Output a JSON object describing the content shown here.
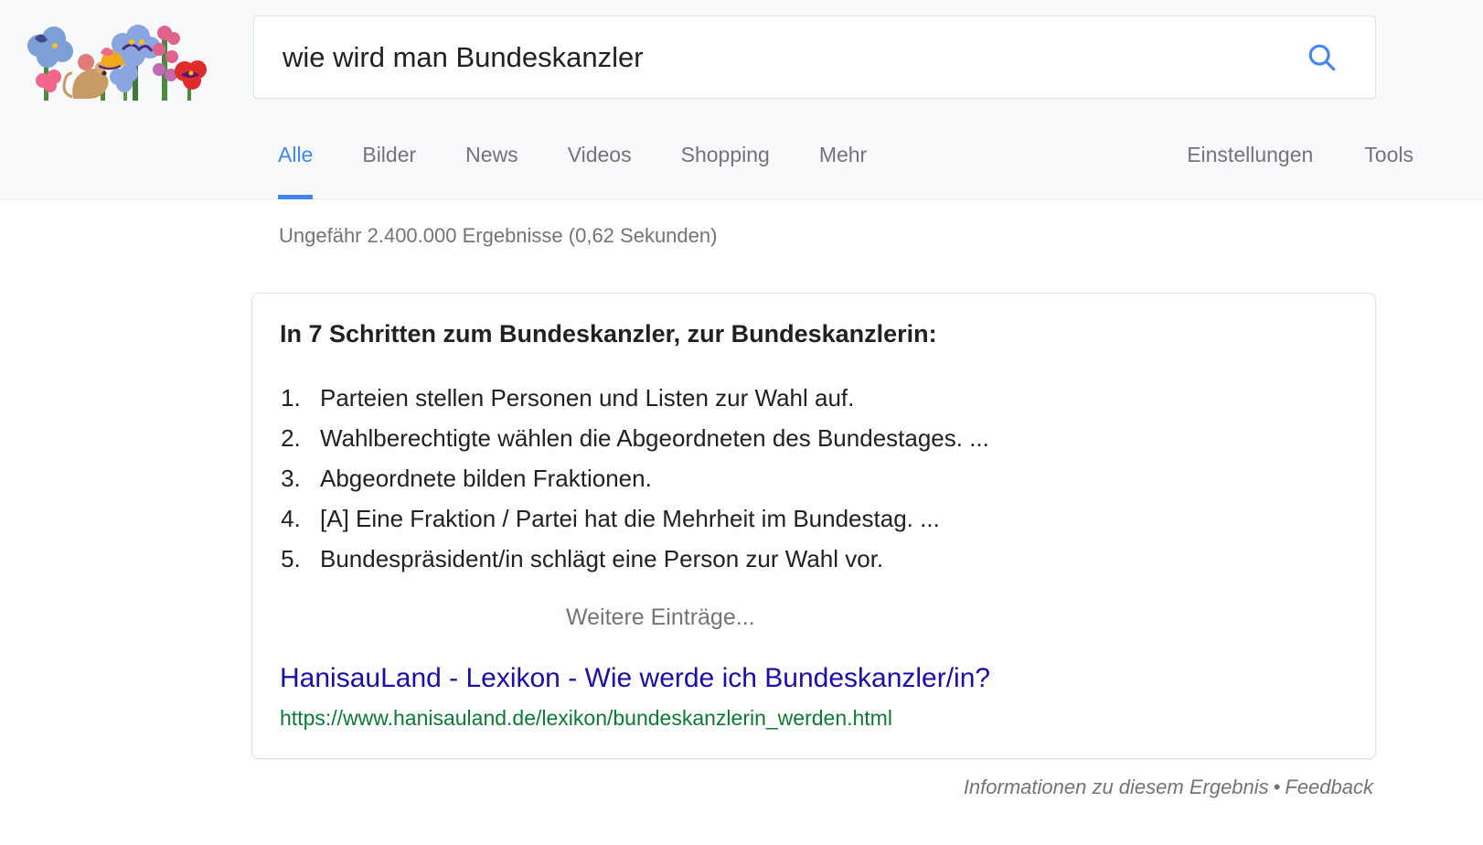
{
  "doodle": {
    "name": "google-doodle-flowers-mouse",
    "description": "Illustrated flowers with a mouse"
  },
  "search": {
    "value": "wie wird man Bundeskanzler",
    "placeholder": "",
    "search_icon": "search-icon"
  },
  "tabs": [
    {
      "label": "Alle",
      "active": true
    },
    {
      "label": "Bilder",
      "active": false
    },
    {
      "label": "News",
      "active": false
    },
    {
      "label": "Videos",
      "active": false
    },
    {
      "label": "Shopping",
      "active": false
    },
    {
      "label": "Mehr",
      "active": false
    }
  ],
  "tools": [
    {
      "label": "Einstellungen"
    },
    {
      "label": "Tools"
    }
  ],
  "result_stats": "Ungefähr 2.400.000 Ergebnisse (0,62 Sekunden)",
  "snippet": {
    "heading": "In 7 Schritten zum Bundeskanzler, zur Bundeskanzlerin:",
    "steps": [
      "Parteien stellen Personen und Listen zur Wahl auf.",
      "Wahlberechtigte wählen die Abgeordneten des Bundestages. ...",
      "Abgeordnete bilden Fraktionen.",
      "[A] Eine Fraktion / Partei hat die Mehrheit im Bundestag. ...",
      "Bundespräsident/in schlägt eine Person zur Wahl vor."
    ],
    "more_entries": "Weitere Einträge...",
    "link_title": "HanisauLand - Lexikon - Wie werde ich Bundeskanzler/in?",
    "link_url": "https://www.hanisauland.de/lexikon/bundeskanzlerin_werden.html"
  },
  "footer": {
    "info_label": "Informationen zu diesem Ergebnis",
    "separator": "•",
    "feedback_label": "Feedback"
  },
  "colors": {
    "accent_blue": "#4285f4",
    "link_blue": "#1a0dab",
    "url_green": "#0b7a33",
    "text_gray": "#70757a",
    "header_bg": "#f8f9fa"
  }
}
